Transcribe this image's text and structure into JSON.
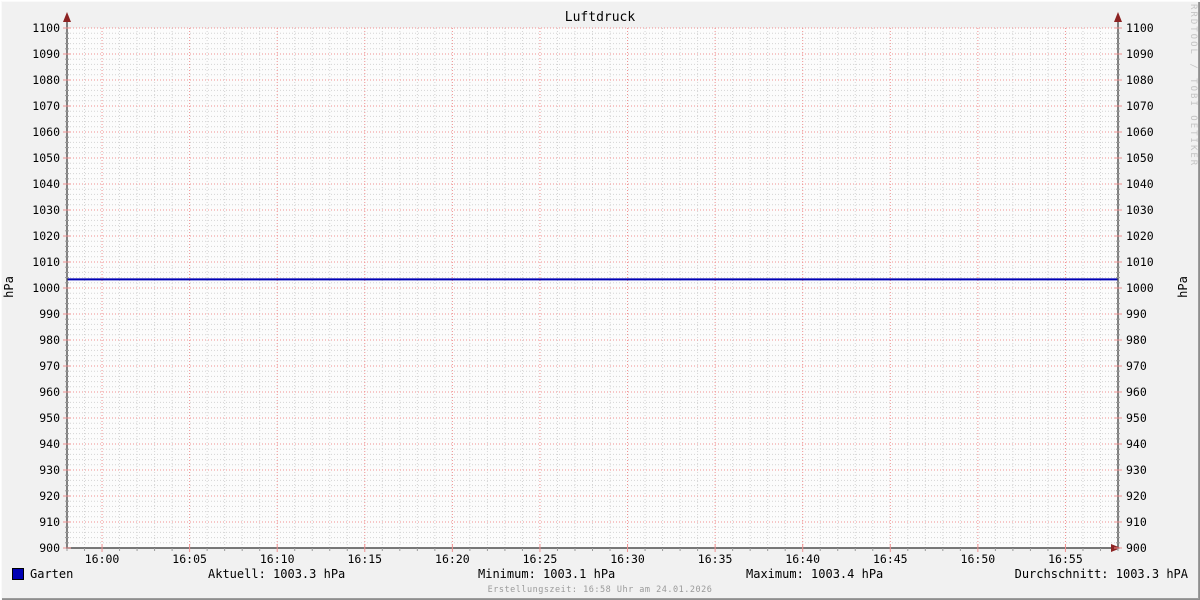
{
  "chart_data": {
    "type": "line",
    "title": "Luftdruck",
    "ylabel_left": "hPa",
    "ylabel_right": "hPa",
    "ylim": [
      900,
      1100
    ],
    "y_major_step": 10,
    "y_minor_step": 2,
    "y_ticks": [
      900,
      910,
      920,
      930,
      940,
      950,
      960,
      970,
      980,
      990,
      1000,
      1010,
      1020,
      1030,
      1040,
      1050,
      1060,
      1070,
      1080,
      1090,
      1100
    ],
    "x_axis": {
      "start_offset_min": -2,
      "end_offset_min": 58,
      "minor_step_min": 1,
      "major_ticks": [
        {
          "t": 0,
          "label": "16:00"
        },
        {
          "t": 5,
          "label": "16:05"
        },
        {
          "t": 10,
          "label": "16:10"
        },
        {
          "t": 15,
          "label": "16:15"
        },
        {
          "t": 20,
          "label": "16:20"
        },
        {
          "t": 25,
          "label": "16:25"
        },
        {
          "t": 30,
          "label": "16:30"
        },
        {
          "t": 35,
          "label": "16:35"
        },
        {
          "t": 40,
          "label": "16:40"
        },
        {
          "t": 45,
          "label": "16:45"
        },
        {
          "t": 50,
          "label": "16:50"
        },
        {
          "t": 55,
          "label": "16:55"
        }
      ]
    },
    "series": [
      {
        "name": "Garten",
        "color": "#0000b4",
        "points": [
          [
            -2,
            1003.3
          ],
          [
            58,
            1003.3
          ]
        ]
      }
    ],
    "stats": {
      "aktuell_hpa": 1003.3,
      "minimum_hpa": 1003.1,
      "maximum_hpa": 1003.4,
      "durchschnitt_hpa": 1003.3
    },
    "colors": {
      "background": "#f1f1f1",
      "canvas": "#fcfcfc",
      "major_grid": "#ef9090",
      "minor_grid": "#d4d4d4",
      "axis": "#4d4d4d",
      "arrow": "#8d2323",
      "minor_tick": "#9a9a9a"
    },
    "legend_position": "bottom",
    "grid": "on"
  },
  "legend": {
    "series_label": "Garten",
    "swatch_color": "#0000b4",
    "aktuell": "Aktuell: 1003.3 hPa",
    "minimum": "Minimum: 1003.1 hPa",
    "maximum": "Maximum: 1003.4 hPa",
    "durchschnitt": "Durchschnitt: 1003.3 hPA"
  },
  "footer": {
    "creation_time": "Erstellungszeit: 16:58 Uhr am 24.01.2026"
  },
  "watermark": "RRDTOOL / TOBI OETIKER"
}
